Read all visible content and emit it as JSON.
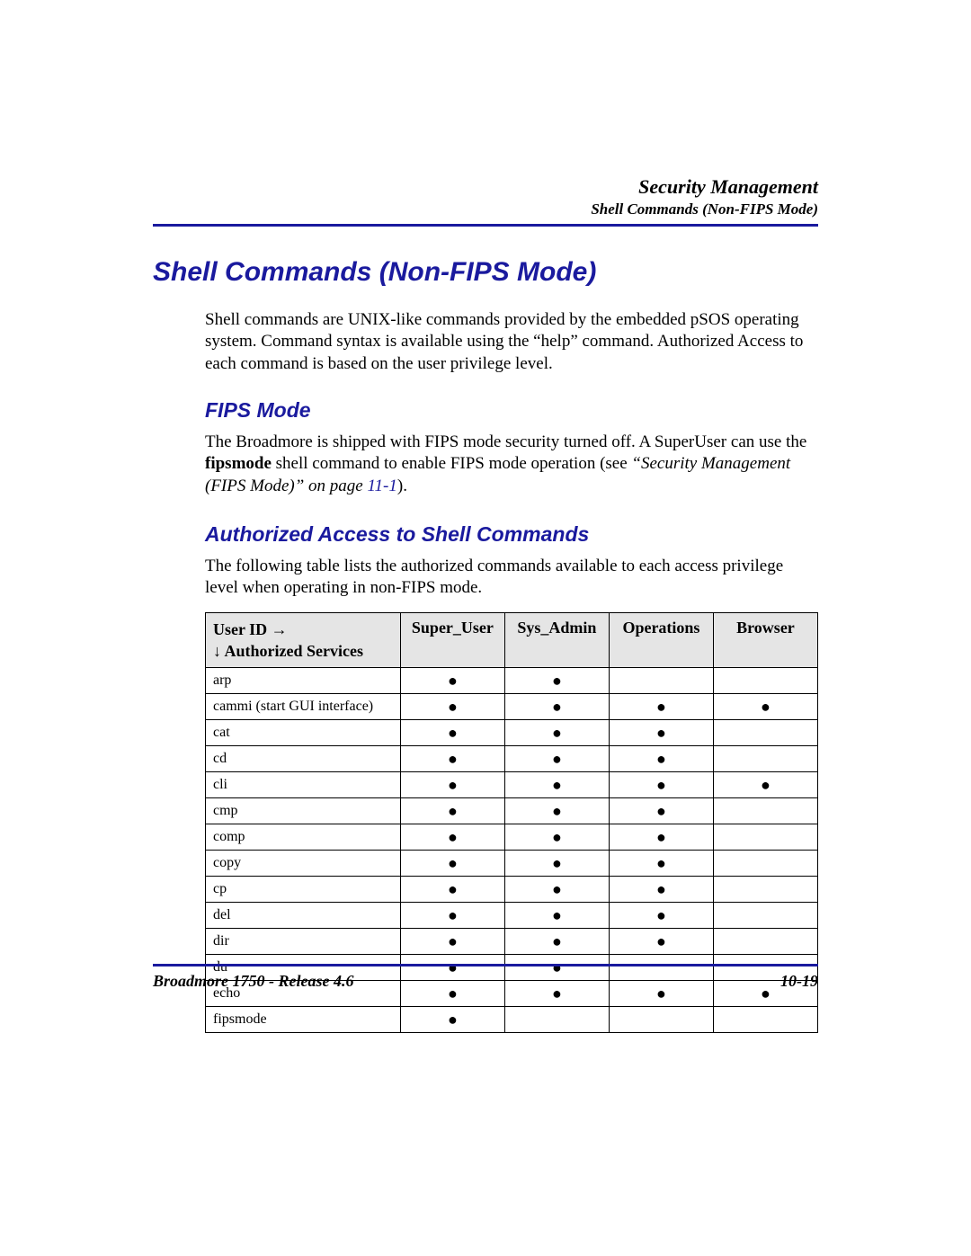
{
  "header": {
    "title": "Security Management",
    "subtitle": "Shell Commands (Non-FIPS Mode)"
  },
  "h1": "Shell Commands (Non-FIPS Mode)",
  "intro": "Shell commands are UNIX-like commands provided by the embedded pSOS operating system. Command syntax is available using the “help” command. Authorized Access to each command is based on the user privilege level.",
  "fips": {
    "heading": "FIPS Mode",
    "p1a": "The Broadmore is shipped with FIPS mode security turned off. A SuperUser can use the ",
    "p1_bold": "fipsmode",
    "p1b": " shell command to enable FIPS mode operation (see ",
    "p1_ital": "“Security Management (FIPS Mode)” on page ",
    "p1_link": "11-1",
    "p1c": ")."
  },
  "auth": {
    "heading": "Authorized Access to Shell Commands",
    "para": "The following table lists the authorized commands available to each access privilege level when operating in non-FIPS mode."
  },
  "table": {
    "hdr_left_line1": "User ID →",
    "hdr_left_line2": "↓ Authorized Services",
    "cols": [
      "Super_User",
      "Sys_Admin",
      "Operations",
      "Browser"
    ],
    "rows": [
      {
        "cmd": "arp",
        "v": [
          true,
          true,
          false,
          false
        ]
      },
      {
        "cmd": "cammi (start GUI interface)",
        "v": [
          true,
          true,
          true,
          true
        ]
      },
      {
        "cmd": "cat",
        "v": [
          true,
          true,
          true,
          false
        ]
      },
      {
        "cmd": "cd",
        "v": [
          true,
          true,
          true,
          false
        ]
      },
      {
        "cmd": "cli",
        "v": [
          true,
          true,
          true,
          true
        ]
      },
      {
        "cmd": "cmp",
        "v": [
          true,
          true,
          true,
          false
        ]
      },
      {
        "cmd": "comp",
        "v": [
          true,
          true,
          true,
          false
        ]
      },
      {
        "cmd": "copy",
        "v": [
          true,
          true,
          true,
          false
        ]
      },
      {
        "cmd": "cp",
        "v": [
          true,
          true,
          true,
          false
        ]
      },
      {
        "cmd": "del",
        "v": [
          true,
          true,
          true,
          false
        ]
      },
      {
        "cmd": "dir",
        "v": [
          true,
          true,
          true,
          false
        ]
      },
      {
        "cmd": "du",
        "v": [
          true,
          true,
          false,
          false
        ]
      },
      {
        "cmd": "echo",
        "v": [
          true,
          true,
          true,
          true
        ]
      },
      {
        "cmd": "fipsmode",
        "v": [
          true,
          false,
          false,
          false
        ]
      }
    ]
  },
  "footer": {
    "left": "Broadmore 1750 - Release 4.6",
    "right": "10-19"
  }
}
